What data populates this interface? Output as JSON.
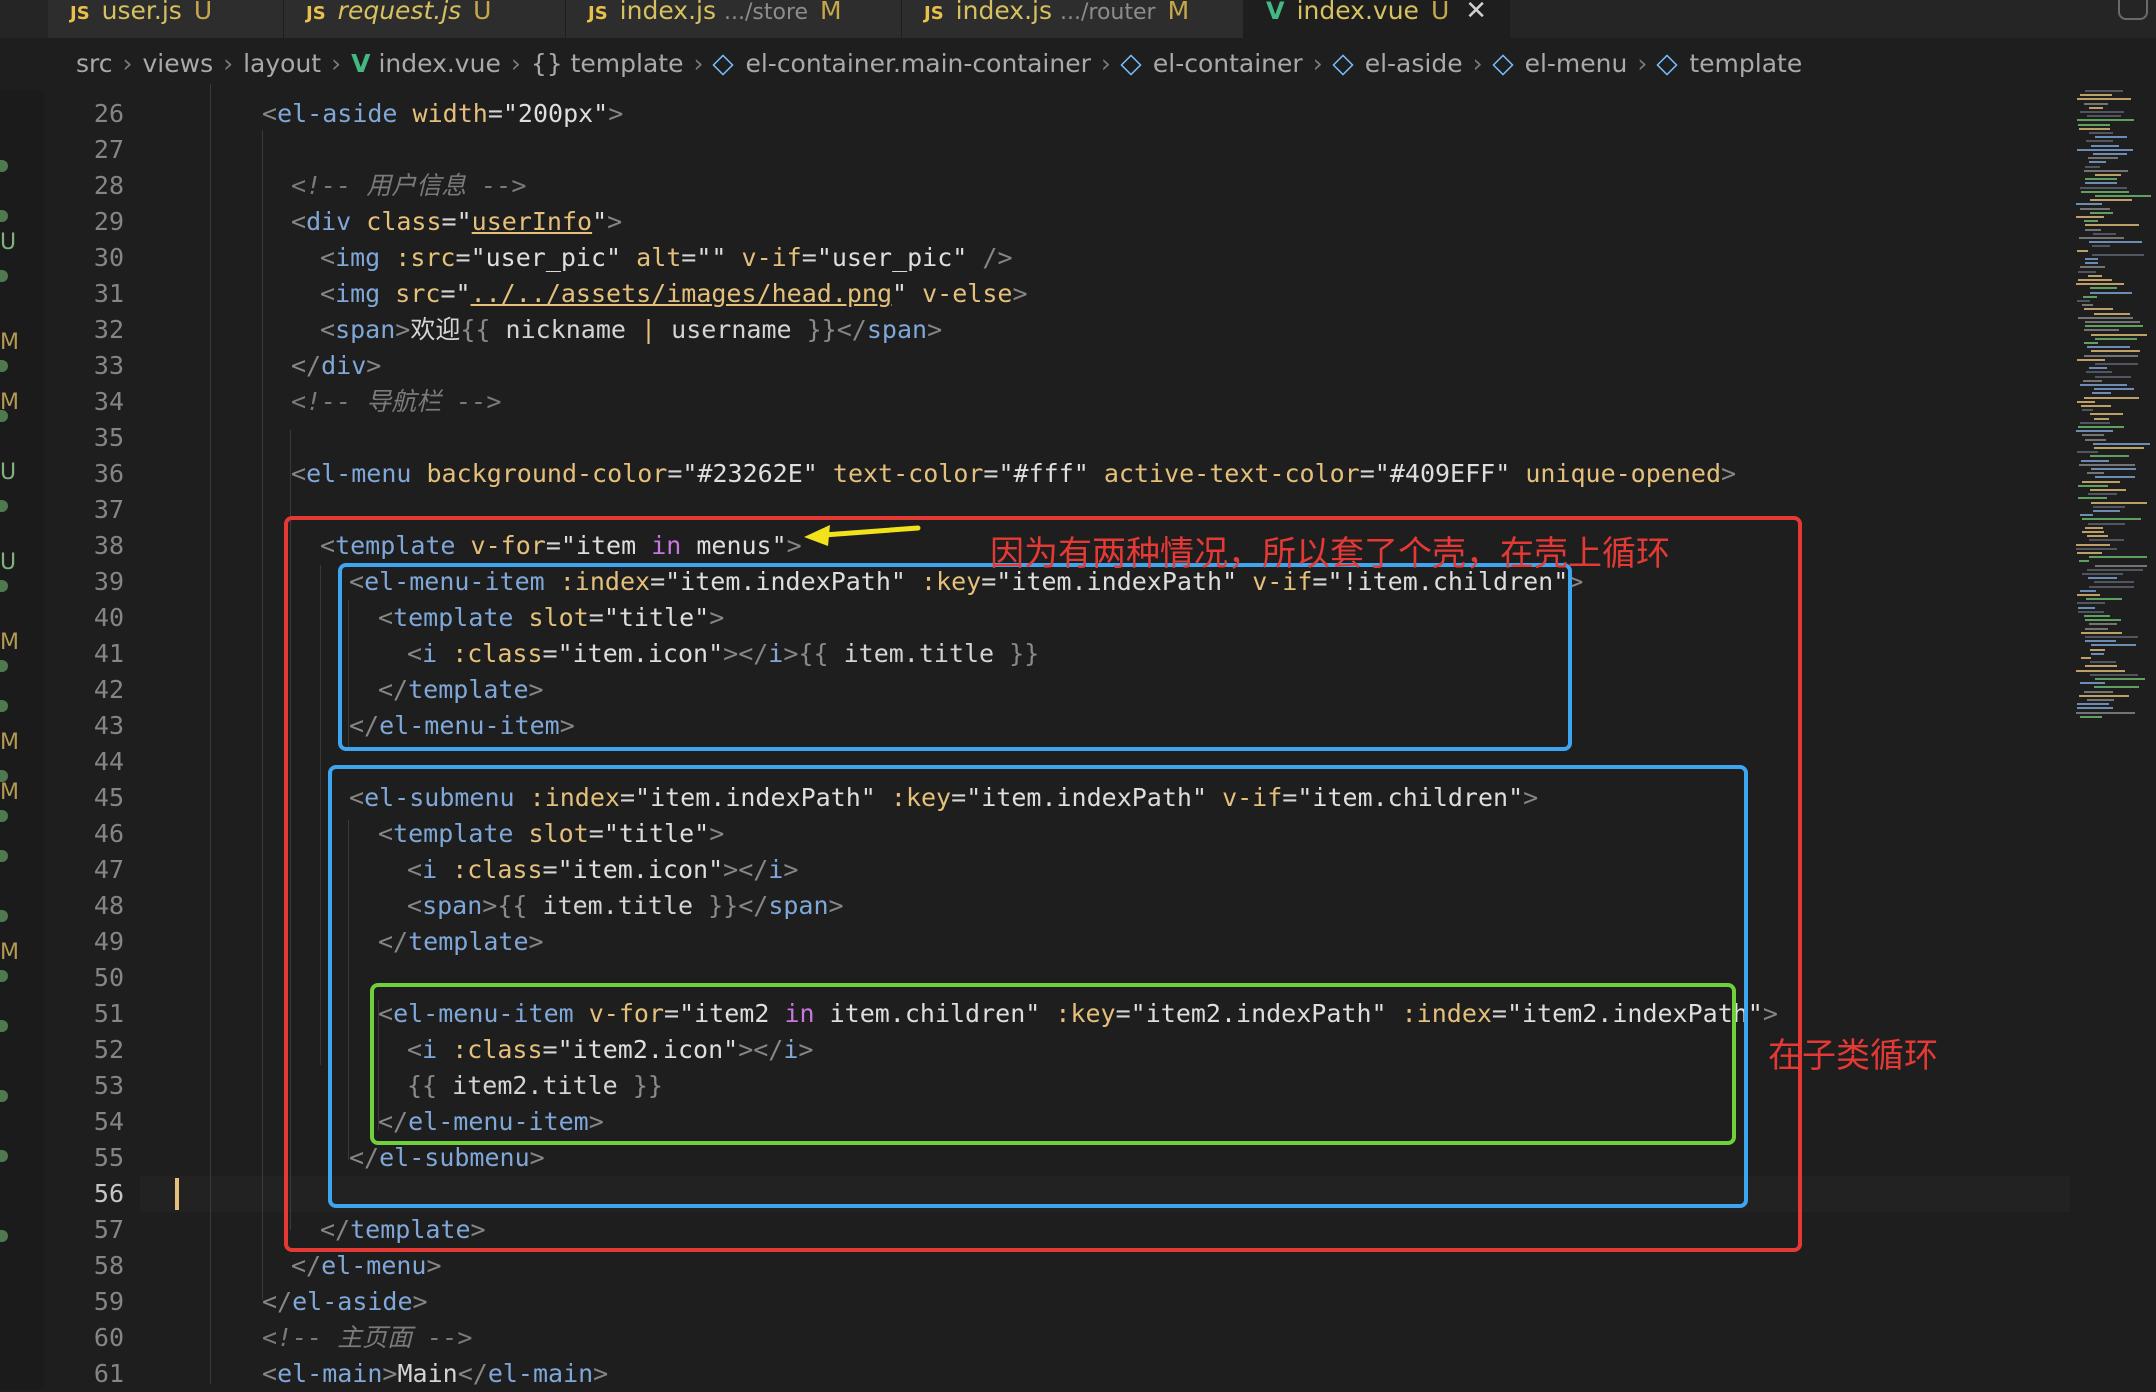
{
  "tabs": [
    {
      "icon": "JS",
      "name": "user.js",
      "dir": "",
      "status": "U",
      "italic": false
    },
    {
      "icon": "JS",
      "name": "request.js",
      "dir": "",
      "status": "U",
      "italic": true
    },
    {
      "icon": "JS",
      "name": "index.js",
      "dir": ".../store",
      "status": "M",
      "italic": false
    },
    {
      "icon": "JS",
      "name": "index.js",
      "dir": ".../router",
      "status": "M",
      "italic": false
    },
    {
      "icon": "V",
      "name": "index.vue",
      "dir": "",
      "status": "U",
      "italic": false,
      "active": true
    }
  ],
  "breadcrumb": [
    "src",
    "views",
    "layout",
    "index.vue",
    "{} template",
    "el-container.main-container",
    "el-container",
    "el-aside",
    "el-menu",
    "template"
  ],
  "lines": [
    {
      "n": 26,
      "indent": 2,
      "html": "<span class='c-punct'>&lt;</span><span class='c-tag'>el-aside</span> <span class='c-attr'>width</span><span class='c-eq'>=</span><span class='c-val'>\"200px\"</span><span class='c-punct'>&gt;</span>"
    },
    {
      "n": 27,
      "indent": 0,
      "html": ""
    },
    {
      "n": 28,
      "indent": 3,
      "html": "<span class='c-cm'>&lt;!-- 用户信息 --&gt;</span>"
    },
    {
      "n": 29,
      "indent": 3,
      "html": "<span class='c-punct'>&lt;</span><span class='c-tag'>div</span> <span class='c-attr'>class</span><span class='c-eq'>=</span><span class='c-val'>\"<span class='ul' style='color:#e5c07b'>userInfo</span>\"</span><span class='c-punct'>&gt;</span>"
    },
    {
      "n": 30,
      "indent": 4,
      "html": "<span class='c-punct'>&lt;</span><span class='c-tag'>img</span> <span class='c-attr'>:src</span><span class='c-eq'>=</span><span class='c-val'>\"user_pic\"</span> <span class='c-attr'>alt</span><span class='c-eq'>=</span><span class='c-val'>\"\"</span> <span class='c-attr'>v-if</span><span class='c-eq'>=</span><span class='c-val'>\"user_pic\"</span> <span class='c-punct'>/&gt;</span>"
    },
    {
      "n": 31,
      "indent": 4,
      "html": "<span class='c-punct'>&lt;</span><span class='c-tag'>img</span> <span class='c-attr'>src</span><span class='c-eq'>=</span><span class='c-val'>\"<span class='ul' style='color:#e5c07b'>../../assets/images/head.png</span>\"</span> <span class='c-attr'>v-else</span><span class='c-punct'>&gt;</span>"
    },
    {
      "n": 32,
      "indent": 4,
      "html": "<span class='c-punct'>&lt;</span><span class='c-tag'>span</span><span class='c-punct'>&gt;</span><span class='c-text'>欢迎</span><span class='c-brace'>{{</span> <span class='c-text'>nickname</span> <span class='c-attr'>|</span> <span class='c-text'>username</span> <span class='c-brace'>}}</span><span class='c-punct'>&lt;/</span><span class='c-tag'>span</span><span class='c-punct'>&gt;</span>"
    },
    {
      "n": 33,
      "indent": 3,
      "html": "<span class='c-punct'>&lt;/</span><span class='c-tag'>div</span><span class='c-punct'>&gt;</span>"
    },
    {
      "n": 34,
      "indent": 3,
      "html": "<span class='c-cm'>&lt;!-- 导航栏 --&gt;</span>"
    },
    {
      "n": 35,
      "indent": 0,
      "html": ""
    },
    {
      "n": 36,
      "indent": 3,
      "html": "<span class='c-punct'>&lt;</span><span class='c-tag'>el-menu</span> <span class='c-attr'>background-color</span><span class='c-eq'>=</span><span class='c-val'>\"#23262E\"</span> <span class='c-attr'>text-color</span><span class='c-eq'>=</span><span class='c-val'>\"#fff\"</span> <span class='c-attr'>active-text-color</span><span class='c-eq'>=</span><span class='c-val'>\"#409EFF\"</span> <span class='c-attr'>unique-opened</span><span class='c-punct'>&gt;</span>"
    },
    {
      "n": 37,
      "indent": 0,
      "html": ""
    },
    {
      "n": 38,
      "indent": 4,
      "html": "<span class='c-punct'>&lt;</span><span class='c-tag'>template</span> <span class='c-attr'>v-for</span><span class='c-eq'>=</span><span class='c-val'>\"item <span class='c-kw'>in</span> menus\"</span><span class='c-punct'>&gt;</span>"
    },
    {
      "n": 39,
      "indent": 5,
      "html": "<span class='c-punct'>&lt;</span><span class='c-tag'>el-menu-item</span> <span class='c-attr'>:index</span><span class='c-eq'>=</span><span class='c-val'>\"item.indexPath\"</span> <span class='c-attr'>:key</span><span class='c-eq'>=</span><span class='c-val'>\"item.indexPath\"</span> <span class='c-attr'>v-if</span><span class='c-eq'>=</span><span class='c-val'>\"!item.children\"</span><span class='c-punct'>&gt;</span>"
    },
    {
      "n": 40,
      "indent": 6,
      "html": "<span class='c-punct'>&lt;</span><span class='c-tag'>template</span> <span class='c-attr'>slot</span><span class='c-eq'>=</span><span class='c-val'>\"title\"</span><span class='c-punct'>&gt;</span>"
    },
    {
      "n": 41,
      "indent": 7,
      "html": "<span class='c-punct'>&lt;</span><span class='c-tag'>i</span> <span class='c-attr'>:class</span><span class='c-eq'>=</span><span class='c-val'>\"item.icon\"</span><span class='c-punct'>&gt;&lt;/</span><span class='c-tag'>i</span><span class='c-punct'>&gt;</span><span class='c-brace'>{{</span> <span class='c-text'>item.title</span> <span class='c-brace'>}}</span>"
    },
    {
      "n": 42,
      "indent": 6,
      "html": "<span class='c-punct'>&lt;/</span><span class='c-tag'>template</span><span class='c-punct'>&gt;</span>"
    },
    {
      "n": 43,
      "indent": 5,
      "html": "<span class='c-punct'>&lt;/</span><span class='c-tag'>el-menu-item</span><span class='c-punct'>&gt;</span>"
    },
    {
      "n": 44,
      "indent": 0,
      "html": ""
    },
    {
      "n": 45,
      "indent": 5,
      "html": "<span class='c-punct'>&lt;</span><span class='c-tag'>el-submenu</span> <span class='c-attr'>:index</span><span class='c-eq'>=</span><span class='c-val'>\"item.indexPath\"</span> <span class='c-attr'>:key</span><span class='c-eq'>=</span><span class='c-val'>\"item.indexPath\"</span> <span class='c-attr'>v-if</span><span class='c-eq'>=</span><span class='c-val'>\"item.children\"</span><span class='c-punct'>&gt;</span>"
    },
    {
      "n": 46,
      "indent": 6,
      "html": "<span class='c-punct'>&lt;</span><span class='c-tag'>template</span> <span class='c-attr'>slot</span><span class='c-eq'>=</span><span class='c-val'>\"title\"</span><span class='c-punct'>&gt;</span>"
    },
    {
      "n": 47,
      "indent": 7,
      "html": "<span class='c-punct'>&lt;</span><span class='c-tag'>i</span> <span class='c-attr'>:class</span><span class='c-eq'>=</span><span class='c-val'>\"item.icon\"</span><span class='c-punct'>&gt;&lt;/</span><span class='c-tag'>i</span><span class='c-punct'>&gt;</span>"
    },
    {
      "n": 48,
      "indent": 7,
      "html": "<span class='c-punct'>&lt;</span><span class='c-tag'>span</span><span class='c-punct'>&gt;</span><span class='c-brace'>{{</span> <span class='c-text'>item.title</span> <span class='c-brace'>}}</span><span class='c-punct'>&lt;/</span><span class='c-tag'>span</span><span class='c-punct'>&gt;</span>"
    },
    {
      "n": 49,
      "indent": 6,
      "html": "<span class='c-punct'>&lt;/</span><span class='c-tag'>template</span><span class='c-punct'>&gt;</span>"
    },
    {
      "n": 50,
      "indent": 0,
      "html": ""
    },
    {
      "n": 51,
      "indent": 6,
      "html": "<span class='c-punct'>&lt;</span><span class='c-tag'>el-menu-item</span> <span class='c-attr'>v-for</span><span class='c-eq'>=</span><span class='c-val'>\"item2 <span class='c-kw'>in</span> item.children\"</span> <span class='c-attr'>:key</span><span class='c-eq'>=</span><span class='c-val'>\"item2.indexPath\"</span> <span class='c-attr'>:index</span><span class='c-eq'>=</span><span class='c-val'>\"item2.indexPath\"</span><span class='c-punct'>&gt;</span>"
    },
    {
      "n": 52,
      "indent": 7,
      "html": "<span class='c-punct'>&lt;</span><span class='c-tag'>i</span> <span class='c-attr'>:class</span><span class='c-eq'>=</span><span class='c-val'>\"item2.icon\"</span><span class='c-punct'>&gt;&lt;/</span><span class='c-tag'>i</span><span class='c-punct'>&gt;</span>"
    },
    {
      "n": 53,
      "indent": 7,
      "html": "<span class='c-brace'>{{</span> <span class='c-text'>item2.title</span> <span class='c-brace'>}}</span>"
    },
    {
      "n": 54,
      "indent": 6,
      "html": "<span class='c-punct'>&lt;/</span><span class='c-tag'>el-menu-item</span><span class='c-punct'>&gt;</span>"
    },
    {
      "n": 55,
      "indent": 5,
      "html": "<span class='c-punct'>&lt;/</span><span class='c-tag'>el-submenu</span><span class='c-punct'>&gt;</span>"
    },
    {
      "n": 56,
      "indent": 0,
      "html": ""
    },
    {
      "n": 57,
      "indent": 4,
      "html": "<span class='c-punct'>&lt;/</span><span class='c-tag'>template</span><span class='c-punct'>&gt;</span>"
    },
    {
      "n": 58,
      "indent": 3,
      "html": "<span class='c-punct'>&lt;/</span><span class='c-tag'>el-menu</span><span class='c-punct'>&gt;</span>"
    },
    {
      "n": 59,
      "indent": 2,
      "html": "<span class='c-punct'>&lt;/</span><span class='c-tag'>el-aside</span><span class='c-punct'>&gt;</span>"
    },
    {
      "n": 60,
      "indent": 2,
      "html": "<span class='c-cm'>&lt;!-- 主页面 --&gt;</span>"
    },
    {
      "n": 61,
      "indent": 2,
      "html": "<span class='c-punct'>&lt;</span><span class='c-tag'>el-main</span><span class='c-punct'>&gt;</span><span class='c-text'>Main</span><span class='c-punct'>&lt;/</span><span class='c-tag'>el-main</span><span class='c-punct'>&gt;</span>"
    }
  ],
  "current_line": 56,
  "activity_marks": [
    "U",
    "M",
    "M",
    "U",
    "U",
    "M",
    "M",
    "M",
    "M"
  ],
  "annotations": {
    "outer_note": "因为有两种情况，所以套了个壳，在壳上循环",
    "child_note": "在子类循环"
  },
  "colors": {
    "red_box": "#e53935",
    "blue_box": "#3ea6f0",
    "green_box": "#6fd13a",
    "arrow": "#f2e21b"
  }
}
